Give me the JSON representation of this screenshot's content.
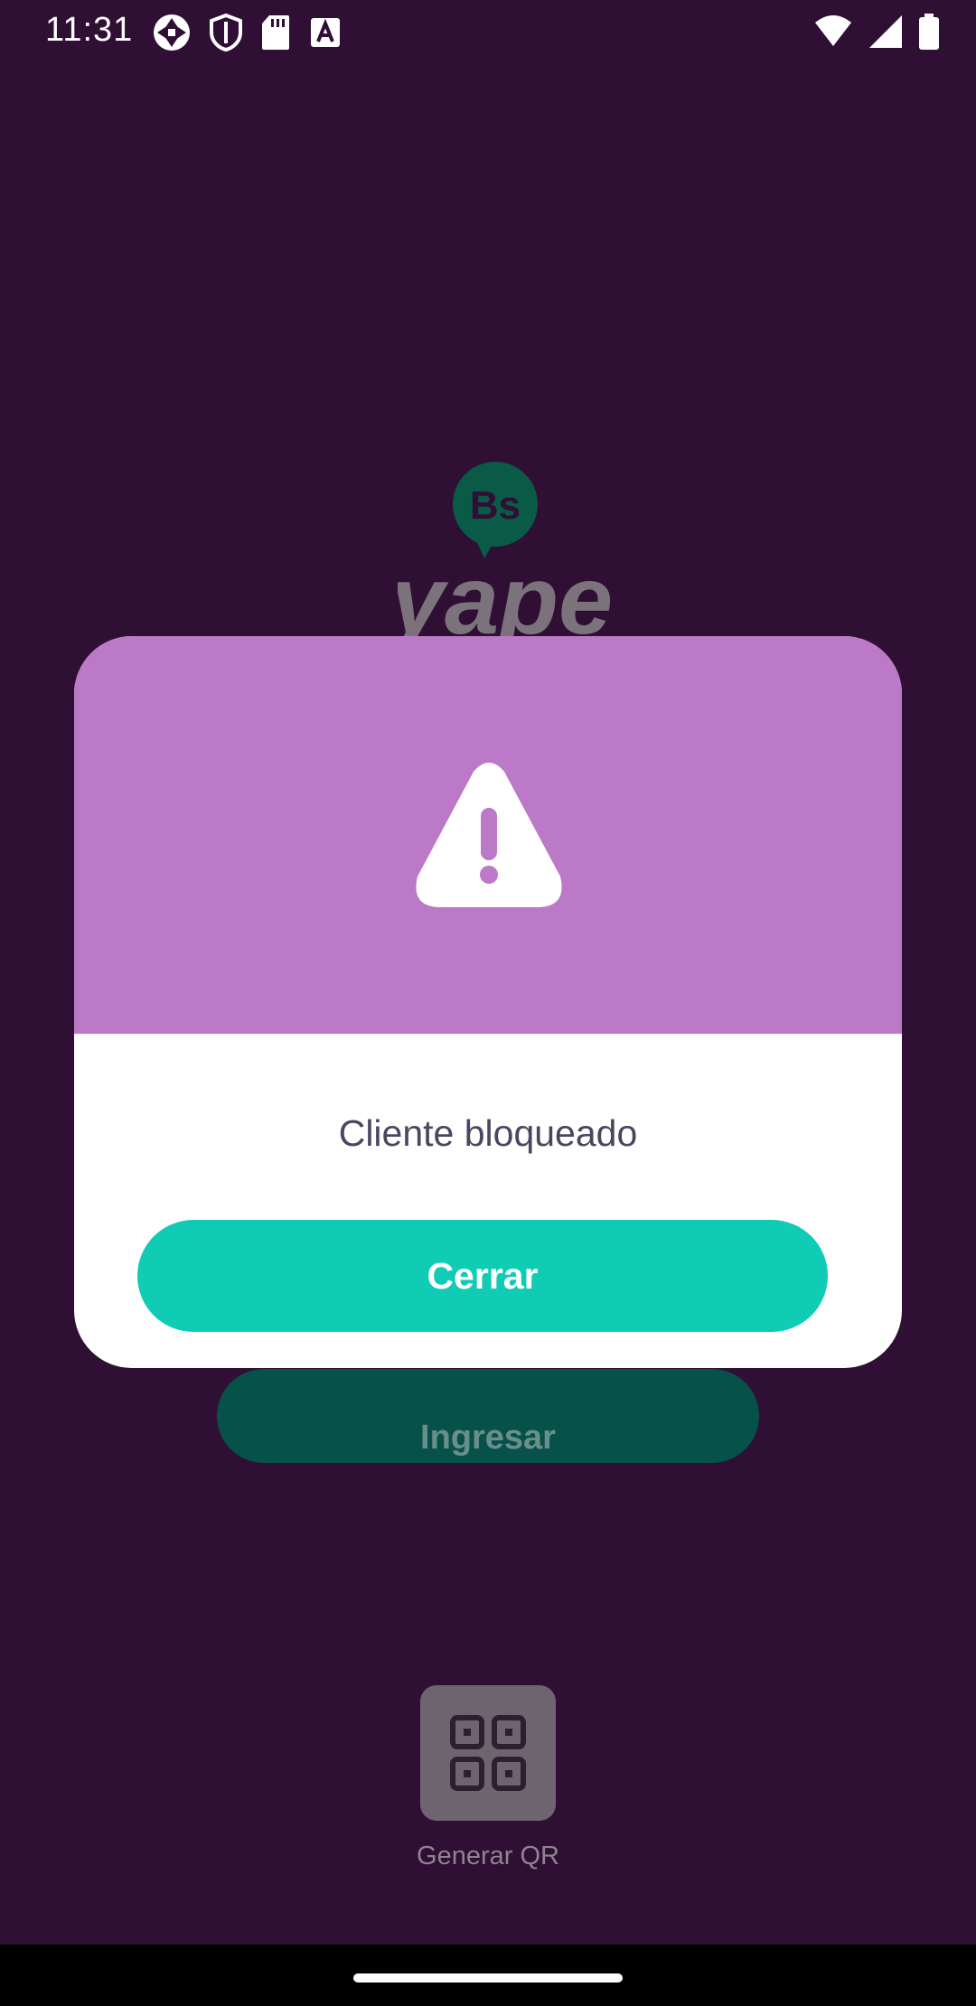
{
  "status_bar": {
    "time": "11:31",
    "left_icons": [
      "camera-aperture-icon",
      "shield-icon",
      "sd-card-icon",
      "text-a-icon"
    ],
    "right_icons": [
      "wifi-icon",
      "cellular-signal-icon",
      "battery-icon"
    ]
  },
  "background": {
    "logo_badge_text": "Bs",
    "logo_wordmark": "yape",
    "login_button_label": "Ingresar",
    "qr_button_label": "Generar QR",
    "qr_icon": "qr-grid-icon"
  },
  "dialog": {
    "icon": "warning-triangle-icon",
    "message": "Cliente bloqueado",
    "close_button_label": "Cerrar"
  },
  "colors": {
    "background": "#2f0f33",
    "dialog_header": "#bc79c7",
    "accent": "#10ccb5",
    "login_button": "#06524a",
    "message_text": "#4b4660"
  }
}
